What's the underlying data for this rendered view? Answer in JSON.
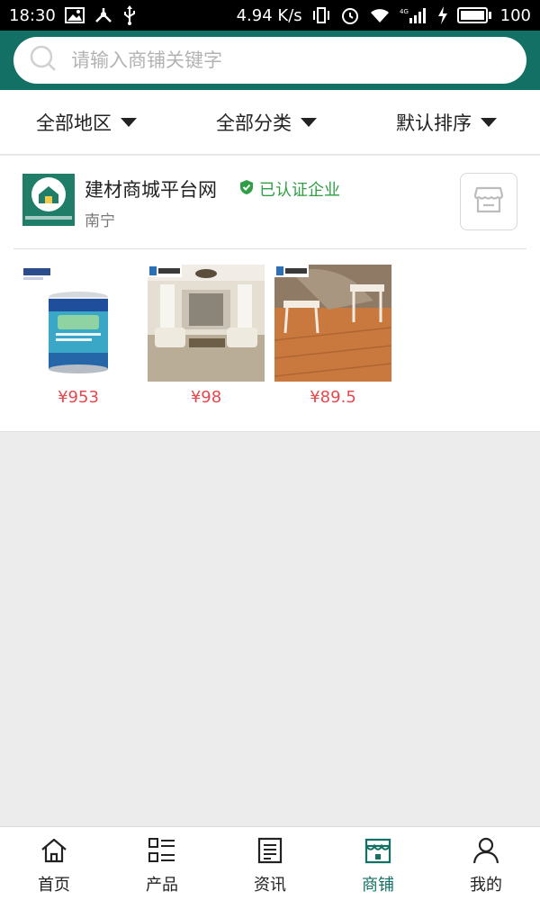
{
  "status_bar": {
    "time": "18:30",
    "speed": "4.94 K/s",
    "network": "4G",
    "battery": "100"
  },
  "search": {
    "placeholder": "请输入商铺关键字",
    "value": ""
  },
  "filters": [
    {
      "label": "全部地区"
    },
    {
      "label": "全部分类"
    },
    {
      "label": "默认排序"
    }
  ],
  "shop": {
    "name": "建材商城平台网",
    "verified_label": "已认证企业",
    "city": "南宁",
    "products": [
      {
        "price": "¥953",
        "image": "paint-bucket"
      },
      {
        "price": "¥98",
        "image": "living-room-floor"
      },
      {
        "price": "¥89.5",
        "image": "wood-floor"
      }
    ]
  },
  "bottom_nav": [
    {
      "label": "首页",
      "icon": "home-icon"
    },
    {
      "label": "产品",
      "icon": "list-icon"
    },
    {
      "label": "资讯",
      "icon": "news-icon"
    },
    {
      "label": "商铺",
      "icon": "store-icon",
      "active": true
    },
    {
      "label": "我的",
      "icon": "user-icon"
    }
  ],
  "colors": {
    "header": "#127065",
    "price": "#e5484d",
    "verified": "#2f9e44",
    "active_nav": "#127065"
  }
}
